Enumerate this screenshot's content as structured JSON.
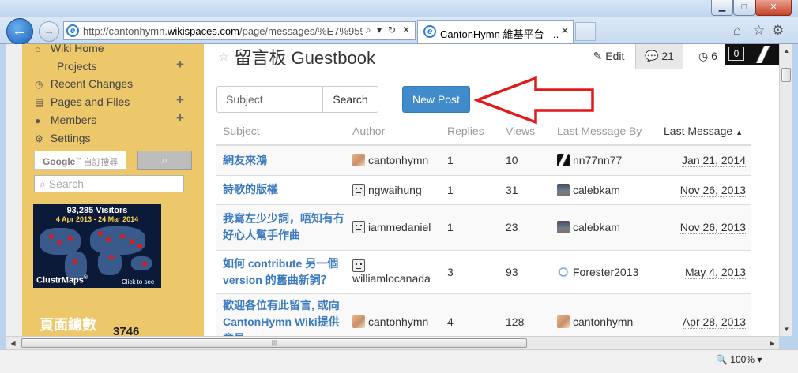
{
  "window": {
    "minimize_label": "▁",
    "maximize_label": "□",
    "close_label": "✕"
  },
  "browser": {
    "back_label": "←",
    "forward_label": "→",
    "url_prefix": "http://cantonhymn.",
    "url_domain": "wikispaces.com",
    "url_path": "/page/messages/%E7%959",
    "search_glyph": "⌕",
    "dropdown_glyph": "▾",
    "refresh_glyph": "↻",
    "stop_glyph": "✕",
    "tab_title": "CantonHymn 維基平台 - ...",
    "tab_close": "✕",
    "ie_glyph": "e",
    "home_glyph": "⌂",
    "favorites_glyph": "☆",
    "tools_glyph": "⚙",
    "zoom": "100%",
    "zoom_glyph": "🔍",
    "zoom_dropdown": "▾"
  },
  "sidebar": {
    "items": [
      {
        "icon": "home-icon",
        "glyph": "⌂",
        "label": "Wiki Home"
      },
      {
        "icon": "",
        "glyph": "",
        "label": "Projects"
      },
      {
        "icon": "clock-icon",
        "glyph": "◷",
        "label": "Recent Changes"
      },
      {
        "icon": "file-icon",
        "glyph": "▤",
        "label": "Pages and Files"
      },
      {
        "icon": "user-icon",
        "glyph": "●",
        "label": "Members"
      },
      {
        "icon": "gear-icon",
        "glyph": "⚙",
        "label": "Settings"
      }
    ],
    "plus": "+",
    "google_brand": "Google",
    "google_tm": "™",
    "google_placeholder": "自訂搜尋",
    "google_search_glyph": "⌕",
    "search_glyph": "⌕",
    "search_placeholder": "Search",
    "map": {
      "visitors": "93,285 Visitors",
      "dates": "4 Apr 2013 - 24 Mar 2014",
      "brand": "ClustrMaps",
      "brand_mark": "®",
      "click": "Click to see"
    },
    "page_count_label": "頁面總數",
    "page_count": "3746"
  },
  "main": {
    "title": "留言板 Guestbook",
    "star_glyph": "☆",
    "edit_glyph": "✎",
    "edit_label": "Edit",
    "comments_glyph": "💬",
    "comments_count": "21",
    "history_glyph": "◷",
    "history_count": "6",
    "overlay_count": "0",
    "subject_placeholder": "Subject",
    "search_label": "Search",
    "new_post_label": "New Post",
    "sort_glyph": "▲",
    "columns": [
      "Subject",
      "Author",
      "Replies",
      "Views",
      "Last Message By",
      "Last Message"
    ],
    "rows": [
      {
        "subject": "網友來鴻",
        "author": "cantonhymn",
        "author_avatar": "sunset",
        "replies": "1",
        "views": "10",
        "last_by": "nn77nn77",
        "last_avatar": "slash",
        "date": "Jan 21, 2014"
      },
      {
        "subject": "詩歌的版權",
        "author": "ngwaihung",
        "author_avatar": "face",
        "replies": "1",
        "views": "31",
        "last_by": "calebkam",
        "last_avatar": "photo",
        "date": "Nov 26, 2013"
      },
      {
        "subject": "我寫左少少詞，唔知有冇好心人幫手作曲",
        "author": "iammedaniel",
        "author_avatar": "face",
        "replies": "1",
        "views": "23",
        "last_by": "calebkam",
        "last_avatar": "photo",
        "date": "Nov 26, 2013"
      },
      {
        "subject": "如何 contribute 另一個 version 的舊曲新詞？",
        "author": "williamlocanada",
        "author_avatar": "face",
        "replies": "3",
        "views": "93",
        "last_by": "Forester2013",
        "last_avatar": "round",
        "date": "May 4, 2013"
      },
      {
        "subject": "歡迎各位有此留言, 或向CantonHymn Wiki提供意見",
        "author": "cantonhymn",
        "author_avatar": "sunset",
        "replies": "4",
        "views": "128",
        "last_by": "cantonhymn",
        "last_avatar": "sunset",
        "date": "Apr 28, 2013"
      }
    ]
  },
  "scroll": {
    "up": "▲",
    "down": "▼",
    "left": "◀",
    "right": "▶",
    "grip": "|||"
  },
  "colors": {
    "sidebar_bg": "#ecc86b",
    "primary": "#428bca",
    "link": "#3a7abf",
    "annotation": "#e0191b"
  }
}
